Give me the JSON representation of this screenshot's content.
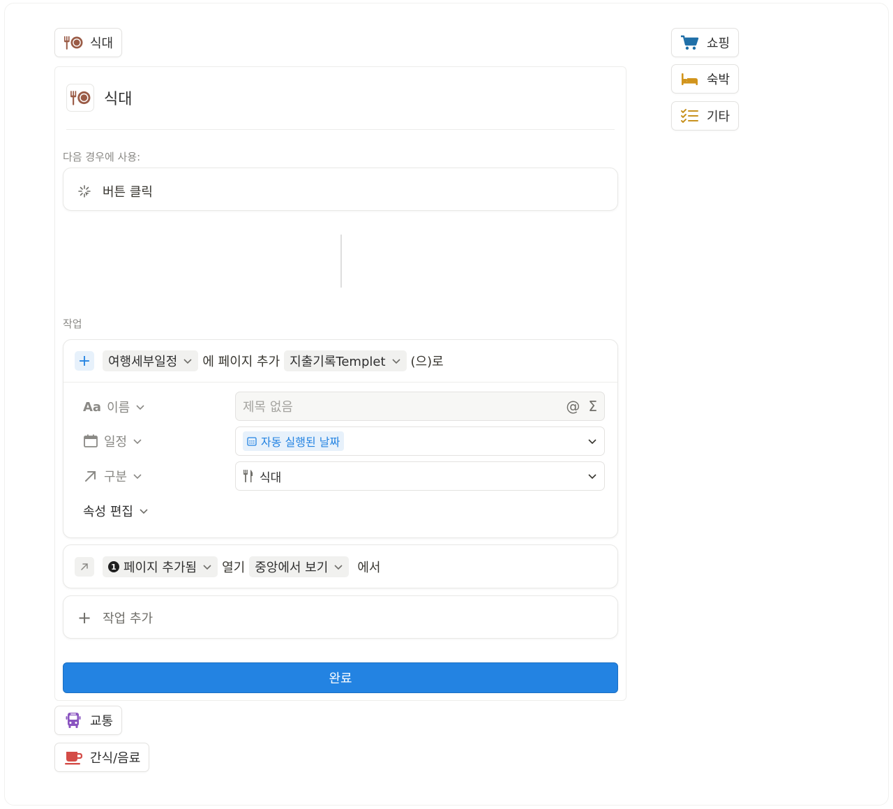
{
  "tabs": {
    "meals": "식대",
    "shopping": "쇼핑",
    "lodging": "숙박",
    "other": "기타",
    "transport": "교통",
    "snacks": "간식/음료"
  },
  "editor": {
    "title": "식대",
    "trigger_label": "다음 경우에 사용:",
    "trigger_value": "버튼 클릭",
    "actions_label": "작업",
    "action1": {
      "database": "여행세부일정",
      "text_add_page": "에 페이지 추가",
      "template": "지출기록Templet",
      "suffix": "(으)로"
    },
    "props": {
      "name_label": "이름",
      "name_prefix": "Aa",
      "name_placeholder": "제목 없음",
      "schedule_label": "일정",
      "schedule_value": "자동 실행된 날짜",
      "category_label": "구분",
      "category_value": "식대",
      "edit_props": "속성 편집"
    },
    "action2": {
      "badge": "1",
      "page_added": "페이지 추가됨",
      "open_text": "열기",
      "view_mode": "중앙에서 보기",
      "suffix": "에서"
    },
    "add_action": "작업 추가",
    "done": "완료"
  },
  "colors": {
    "accent": "#2383e2",
    "meals_icon": "#9a5b46",
    "shopping_icon": "#1f6fa8",
    "lodging_icon": "#d1941c",
    "other_icon": "#c8921f",
    "transport_icon": "#8a54c0",
    "snacks_icon": "#d44c47"
  }
}
